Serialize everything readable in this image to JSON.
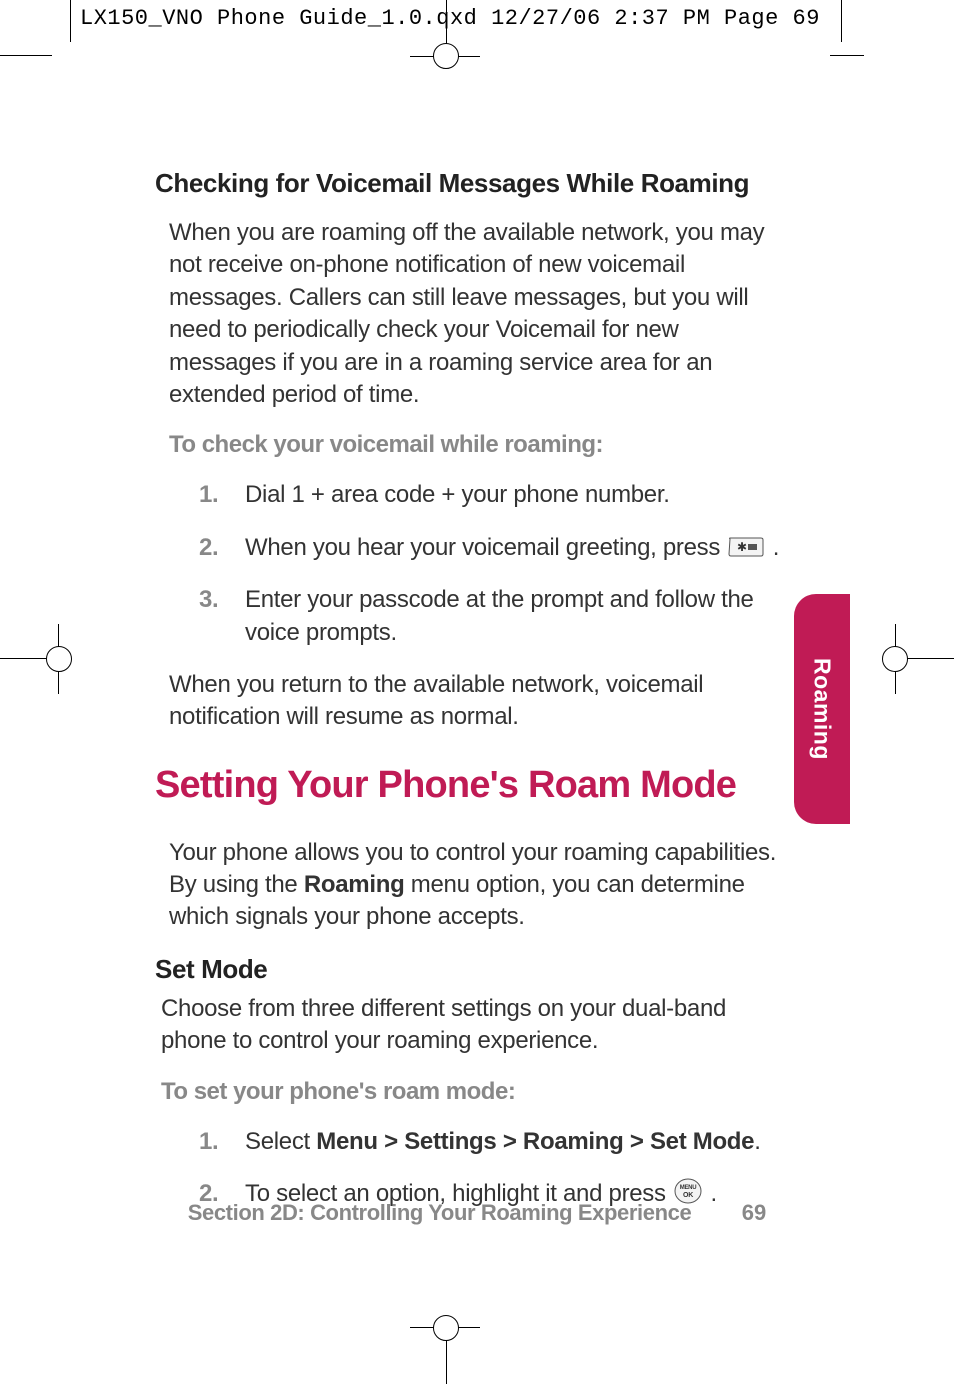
{
  "slug": "LX150_VNO Phone Guide_1.0.qxd  12/27/06  2:37 PM  Page 69",
  "section_a": {
    "heading": "Checking for Voicemail Messages While Roaming",
    "para1": "When you are roaming off the available network, you may not receive on-phone notification of new voicemail messages. Callers can still leave messages, but you will need to periodically check your Voicemail for new messages if you are in a roaming service area for an extended period of time.",
    "subhead": "To check your voicemail while roaming:",
    "steps": {
      "n1": "1.",
      "s1": "Dial 1 + area code + your phone number.",
      "n2": "2.",
      "s2a": "When you hear your voicemail greeting, press ",
      "s2b": ".",
      "n3": "3.",
      "s3": "Enter your passcode at the prompt and follow the voice prompts."
    },
    "para2": "When you return to the available network, voicemail notification will resume as normal."
  },
  "section_b": {
    "h1": "Setting Your Phone's Roam Mode",
    "para1a": "Your phone allows you to control your roaming capabilities. By using the ",
    "para1bold": "Roaming",
    "para1b": " menu option, you can determine which signals your phone accepts.",
    "h3": "Set Mode",
    "para2": "Choose from three different settings on your dual-band phone to control your roaming experience.",
    "subhead": "To set your phone's roam mode:",
    "steps": {
      "n1": "1.",
      "s1a": "Select ",
      "s1bold": "Menu > Settings > Roaming > Set Mode",
      "s1b": ".",
      "n2": "2.",
      "s2a": "To select an option, highlight it and press ",
      "s2b": "."
    }
  },
  "tab_label": "Roaming",
  "footer": {
    "section": "Section 2D: Controlling Your Roaming Experience",
    "page": "69"
  },
  "icons": {
    "star_key": "star-key-icon",
    "ok_key": "menu-ok-key-icon"
  }
}
